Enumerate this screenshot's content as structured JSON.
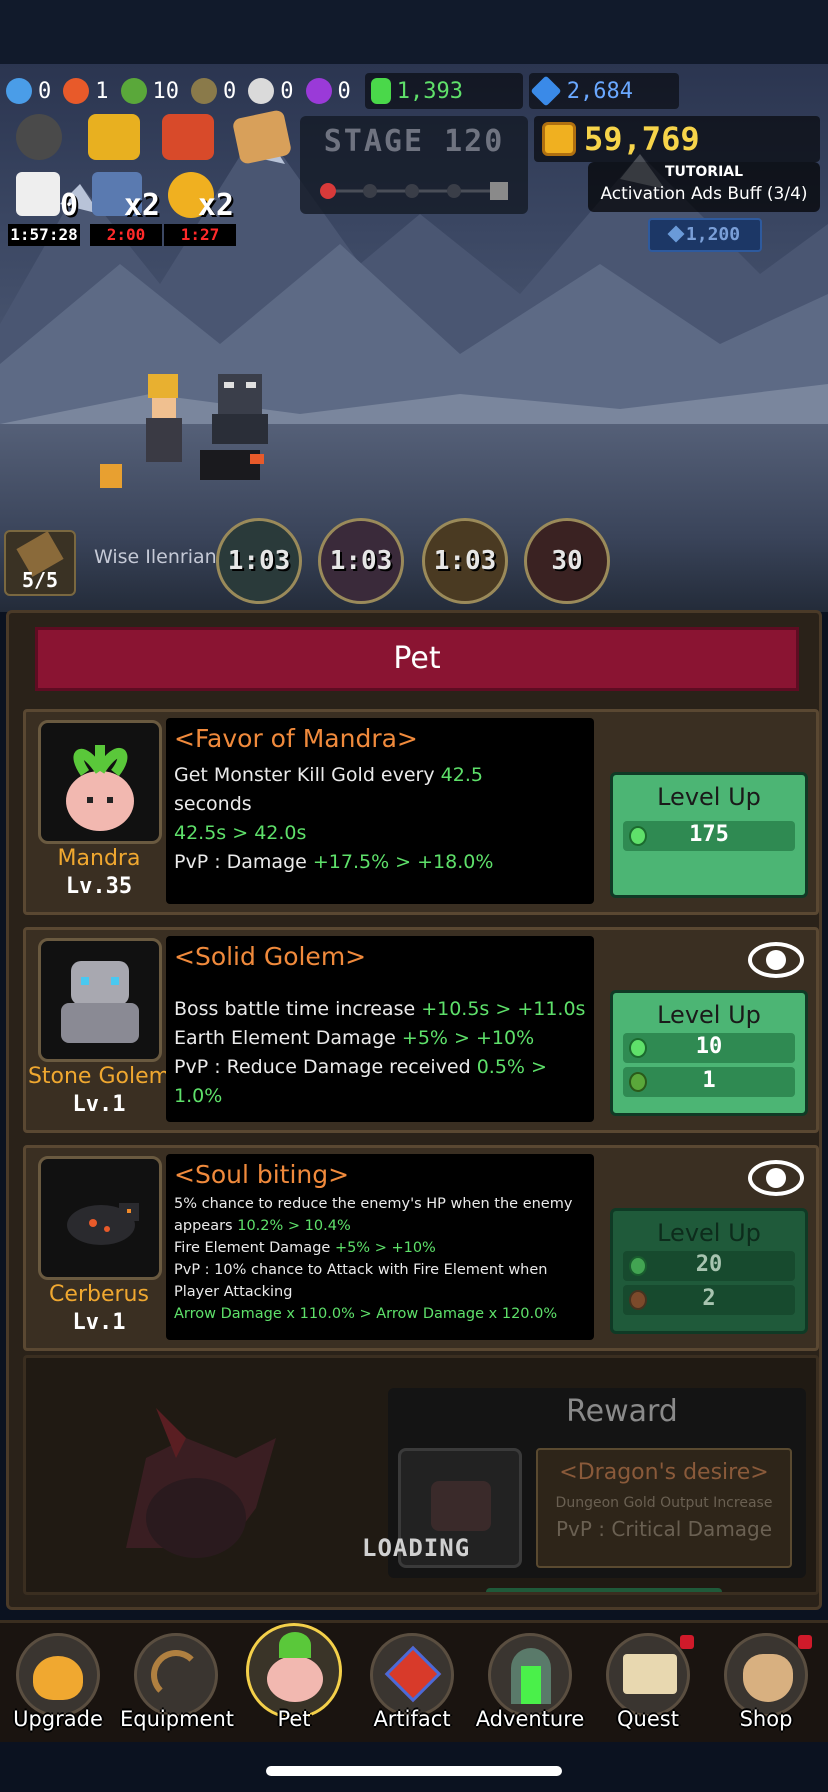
{
  "currencies": [
    {
      "icon": "water-drop-icon",
      "value": "0",
      "color": "#4a9de8"
    },
    {
      "icon": "fire-orb-icon",
      "value": "1",
      "color": "#e85a2a"
    },
    {
      "icon": "goblin-head-icon",
      "value": "10",
      "color": "#5aa83a"
    },
    {
      "icon": "gear-stone-icon",
      "value": "0",
      "color": "#8a7a4a"
    },
    {
      "icon": "pearl-icon",
      "value": "0",
      "color": "#dadada"
    },
    {
      "icon": "purple-gem-icon",
      "value": "0",
      "color": "#9a3ad8"
    }
  ],
  "emerald": {
    "icon": "emerald-icon",
    "value": "1,393"
  },
  "diamond": {
    "icon": "diamond-icon",
    "value": "2,684"
  },
  "stage": {
    "label": "STAGE 120"
  },
  "gold": {
    "value": "59,769"
  },
  "tutorial": {
    "title": "TUTORIAL",
    "text": "Activation Ads Buff (3/4)",
    "cost": "1,200"
  },
  "buffs": [
    {
      "icon": "dice-icon",
      "value": "0",
      "timer": "1:57:28",
      "timer_color": "#ffffff"
    },
    {
      "icon": "attack-speed-icon",
      "value": "x2",
      "timer": "2:00",
      "timer_color": "#ff2a2a"
    },
    {
      "icon": "gold-coin-icon",
      "value": "x2",
      "timer": "1:27",
      "timer_color": "#ff2a2a"
    }
  ],
  "character": {
    "label": "Wise Ilenrian"
  },
  "arrows": {
    "count": "5/5"
  },
  "skills": [
    {
      "icon": "wind-skill-icon",
      "value": "1:03",
      "bg": "#2a3a3a"
    },
    {
      "icon": "shadow-skill-icon",
      "value": "1:03",
      "bg": "#3a2a3a"
    },
    {
      "icon": "earth-skill-icon",
      "value": "1:03",
      "bg": "#4a3a22"
    },
    {
      "icon": "fire-skill-icon",
      "value": "30",
      "bg": "#3a2222"
    }
  ],
  "panel": {
    "title": "Pet"
  },
  "pets": [
    {
      "name": "Mandra",
      "level": "Lv.35",
      "title": "<Favor of Mandra>",
      "lines": [
        {
          "pre": "Get Monster Kill Gold every ",
          "hl": "42.5",
          "post": ""
        },
        {
          "pre": "seconds",
          "hl": "",
          "post": ""
        },
        {
          "pre": "",
          "hl": "42.5s > 42.0s",
          "post": ""
        },
        {
          "pre": "PvP : Damage ",
          "hl": "+17.5% > +18.0%",
          "post": ""
        }
      ],
      "button": {
        "label": "Level Up",
        "costs": [
          {
            "icon": "emerald-icon",
            "value": "175"
          }
        ]
      }
    },
    {
      "name": "Stone Golem",
      "level": "Lv.1",
      "title": "<Solid Golem>",
      "lines": [
        {
          "pre": "Boss battle time increase ",
          "hl": "+10.5s > +11.0s",
          "post": ""
        },
        {
          "pre": "Earth Element Damage ",
          "hl": "+5% > +10%",
          "post": ""
        },
        {
          "pre": "PvP : Reduce Damage received ",
          "hl": "0.5% > 1.0%",
          "post": ""
        }
      ],
      "button": {
        "label": "Level Up",
        "costs": [
          {
            "icon": "emerald-icon",
            "value": "10"
          },
          {
            "icon": "goblin-head-icon",
            "value": "1"
          }
        ]
      }
    },
    {
      "name": "Cerberus",
      "level": "Lv.1",
      "title": "<Soul biting>",
      "lines": [
        {
          "pre": "5% chance to reduce the enemy's HP when the enemy",
          "hl": "",
          "post": ""
        },
        {
          "pre": "appears ",
          "hl": "10.2% > 10.4%",
          "post": ""
        },
        {
          "pre": "Fire Element Damage ",
          "hl": "+5% > +10%",
          "post": ""
        },
        {
          "pre": "PvP : 10% chance to Attack with Fire Element when",
          "hl": "",
          "post": ""
        },
        {
          "pre": "Player Attacking",
          "hl": "",
          "post": ""
        },
        {
          "pre": "",
          "hl": "Arrow Damage x 110.0% > Arrow Damage x 120.0%",
          "post": ""
        }
      ],
      "button": {
        "label": "Level Up",
        "costs": [
          {
            "icon": "emerald-icon",
            "value": "20"
          },
          {
            "icon": "fire-orb-icon",
            "value": "2"
          }
        ]
      }
    }
  ],
  "loading_card": {
    "reward_title": "Reward",
    "reward_name": "<Dragon's desire>",
    "reward_line1": "Dungeon Gold Output Increase",
    "reward_line2": "PvP : Critical Damage",
    "loading": "LOADING"
  },
  "nav": [
    {
      "label": "Upgrade",
      "icon": "upgrade-slime-icon",
      "badge": false,
      "selected": false
    },
    {
      "label": "Equipment",
      "icon": "bow-icon",
      "badge": false,
      "selected": false
    },
    {
      "label": "Pet",
      "icon": "mandra-pet-icon",
      "badge": false,
      "selected": true
    },
    {
      "label": "Artifact",
      "icon": "red-gem-icon",
      "badge": false,
      "selected": false
    },
    {
      "label": "Adventure",
      "icon": "portal-icon",
      "badge": false,
      "selected": false
    },
    {
      "label": "Quest",
      "icon": "scroll-icon",
      "badge": true,
      "selected": false
    },
    {
      "label": "Shop",
      "icon": "money-bag-icon",
      "badge": true,
      "selected": false
    }
  ]
}
